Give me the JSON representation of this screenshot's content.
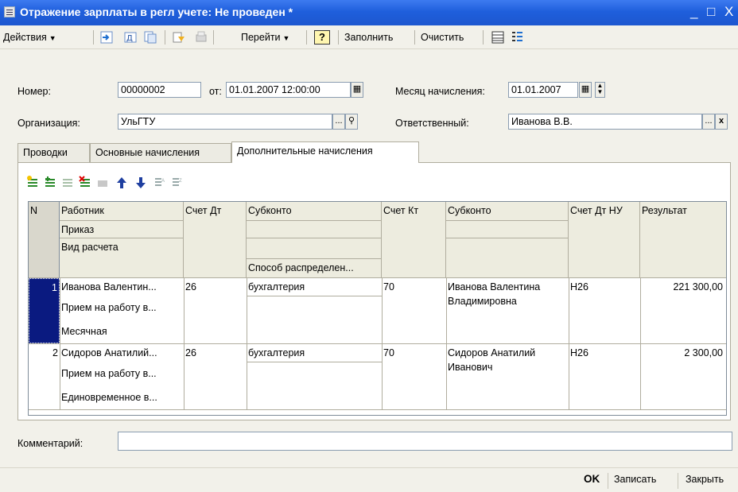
{
  "window": {
    "title": "Отражение зарплаты в регл учете: Не проведен *",
    "minimize": "_",
    "maximize": "□",
    "close": "X"
  },
  "toolbar": {
    "actions": "Действия",
    "goto": "Перейти",
    "help": "?",
    "fill": "Заполнить",
    "clear": "Очистить"
  },
  "form": {
    "number_label": "Номер:",
    "number_value": "00000002",
    "from_label": "от:",
    "date_value": "01.01.2007 12:00:00",
    "month_label": "Месяц начисления:",
    "month_value": "01.01.2007",
    "org_label": "Организация:",
    "org_value": "УльГТУ",
    "resp_label": "Ответственный:",
    "resp_value": "Иванова В.В.",
    "ellipsis": "...",
    "clear_x": "x"
  },
  "tabs": [
    {
      "label": "Проводки"
    },
    {
      "label": "Основные начисления"
    },
    {
      "label": "Дополнительные начисления"
    }
  ],
  "grid": {
    "headers": {
      "n": "N",
      "worker": "Работник",
      "order": "Приказ",
      "calc_type": "Вид расчета",
      "debit": "Счет Дт",
      "subconto1": "Субконто",
      "distribution": "Способ распределен...",
      "credit": "Счет Кт",
      "subconto2": "Субконто",
      "debit_nu": "Счет Дт НУ",
      "result": "Результат"
    },
    "rows": [
      {
        "n": "1",
        "worker": "Иванова Валентин...",
        "order": "Прием на работу в...",
        "calc_type": "Месячная",
        "debit": "26",
        "subconto1": "бухгалтерия",
        "credit": "70",
        "subconto2_line1": "Иванова Валентина",
        "subconto2_line2": "Владимировна",
        "debit_nu": "Н26",
        "result": "221 300,00"
      },
      {
        "n": "2",
        "worker": "Сидоров Анатилий...",
        "order": "Прием на работу в...",
        "calc_type": "Единовременное в...",
        "debit": "26",
        "subconto1": "бухгалтерия",
        "credit": "70",
        "subconto2_line1": "Сидоров Анатилий",
        "subconto2_line2": "Иванович",
        "debit_nu": "Н26",
        "result": "2 300,00"
      }
    ]
  },
  "comment": {
    "label": "Комментарий:",
    "value": ""
  },
  "buttons": {
    "ok": "OK",
    "save": "Записать",
    "close": "Закрыть"
  },
  "colors": {
    "titlebar": "#1f5fdc",
    "selected_row_marker": "#000080"
  }
}
